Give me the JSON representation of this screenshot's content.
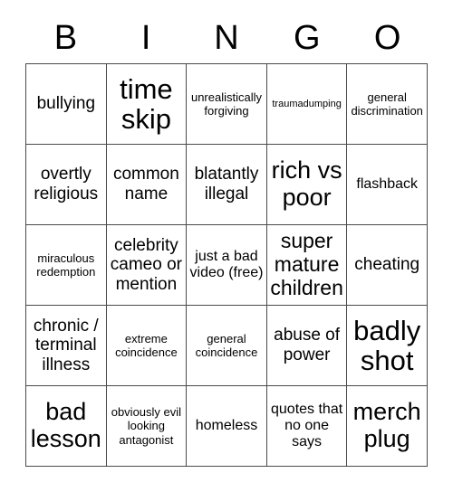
{
  "card": {
    "title": "BINGO",
    "header_letters": [
      "B",
      "I",
      "N",
      "G",
      "O"
    ],
    "colors": {
      "background": "#ffffff",
      "text": "#000000",
      "grid_line": "#4a4a4a"
    },
    "grid": {
      "columns": 5,
      "rows": 5
    },
    "cells": [
      {
        "text": "bullying",
        "size": "lg"
      },
      {
        "text": "time skip",
        "size": "huge"
      },
      {
        "text": "unrealistically forgiving",
        "size": "sm"
      },
      {
        "text": "traumadumping",
        "size": "xs"
      },
      {
        "text": "general discrimination",
        "size": "sm"
      },
      {
        "text": "overtly religious",
        "size": "lg"
      },
      {
        "text": "common name",
        "size": "lg"
      },
      {
        "text": "blatantly illegal",
        "size": "lg"
      },
      {
        "text": "rich vs poor",
        "size": "xxl"
      },
      {
        "text": "flashback",
        "size": "md"
      },
      {
        "text": "miraculous redemption",
        "size": "sm"
      },
      {
        "text": "celebrity cameo or mention",
        "size": "lg"
      },
      {
        "text": "just a bad video (free)",
        "size": "md"
      },
      {
        "text": "super mature children",
        "size": "xl"
      },
      {
        "text": "cheating",
        "size": "lg"
      },
      {
        "text": "chronic / terminal illness",
        "size": "lg"
      },
      {
        "text": "extreme coincidence",
        "size": "sm"
      },
      {
        "text": "general coincidence",
        "size": "sm"
      },
      {
        "text": "abuse of power",
        "size": "lg"
      },
      {
        "text": "badly shot",
        "size": "huge"
      },
      {
        "text": "bad lesson",
        "size": "xxl"
      },
      {
        "text": "obviously evil looking antagonist",
        "size": "sm"
      },
      {
        "text": "homeless",
        "size": "md"
      },
      {
        "text": "quotes that no one says",
        "size": "md"
      },
      {
        "text": "merch plug",
        "size": "xxl"
      }
    ]
  }
}
